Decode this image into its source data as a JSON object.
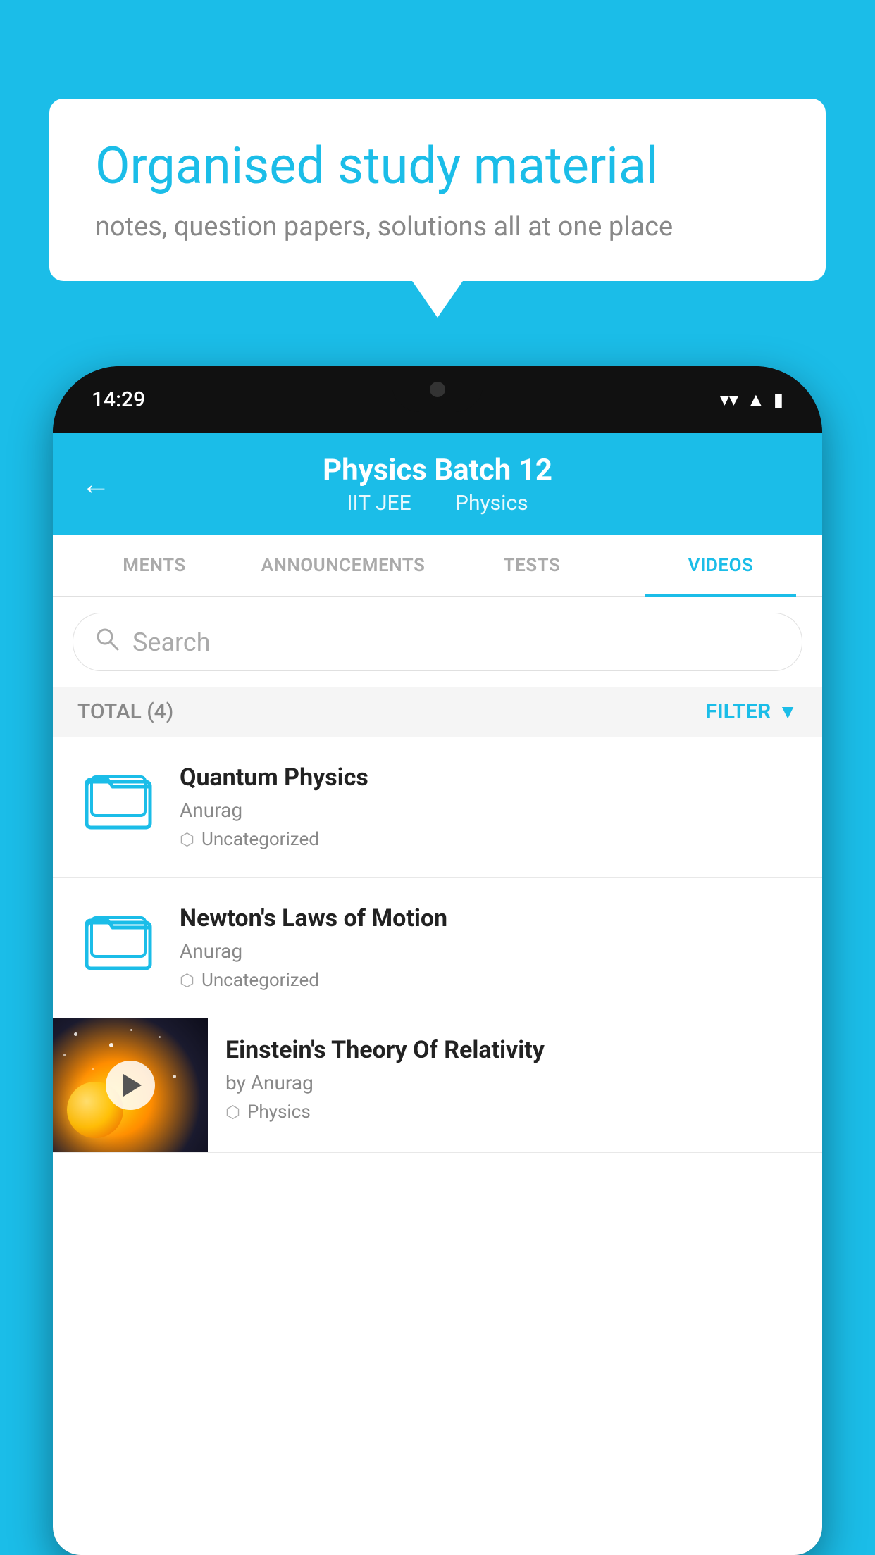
{
  "background_color": "#1BBDE8",
  "speech_bubble": {
    "title": "Organised study material",
    "subtitle": "notes, question papers, solutions all at one place"
  },
  "phone": {
    "status_bar": {
      "time": "14:29",
      "icons": [
        "wifi",
        "signal",
        "battery"
      ]
    },
    "header": {
      "back_label": "←",
      "title": "Physics Batch 12",
      "subtitle_left": "IIT JEE",
      "subtitle_right": "Physics"
    },
    "tabs": [
      {
        "label": "MENTS",
        "active": false
      },
      {
        "label": "ANNOUNCEMENTS",
        "active": false
      },
      {
        "label": "TESTS",
        "active": false
      },
      {
        "label": "VIDEOS",
        "active": true
      }
    ],
    "search": {
      "placeholder": "Search"
    },
    "filter_bar": {
      "total_label": "TOTAL (4)",
      "filter_label": "FILTER"
    },
    "video_items": [
      {
        "id": 1,
        "title": "Quantum Physics",
        "author": "Anurag",
        "tag": "Uncategorized",
        "has_thumbnail": false
      },
      {
        "id": 2,
        "title": "Newton's Laws of Motion",
        "author": "Anurag",
        "tag": "Uncategorized",
        "has_thumbnail": false
      },
      {
        "id": 3,
        "title": "Einstein's Theory Of Relativity",
        "author": "by Anurag",
        "tag": "Physics",
        "has_thumbnail": true
      }
    ]
  }
}
